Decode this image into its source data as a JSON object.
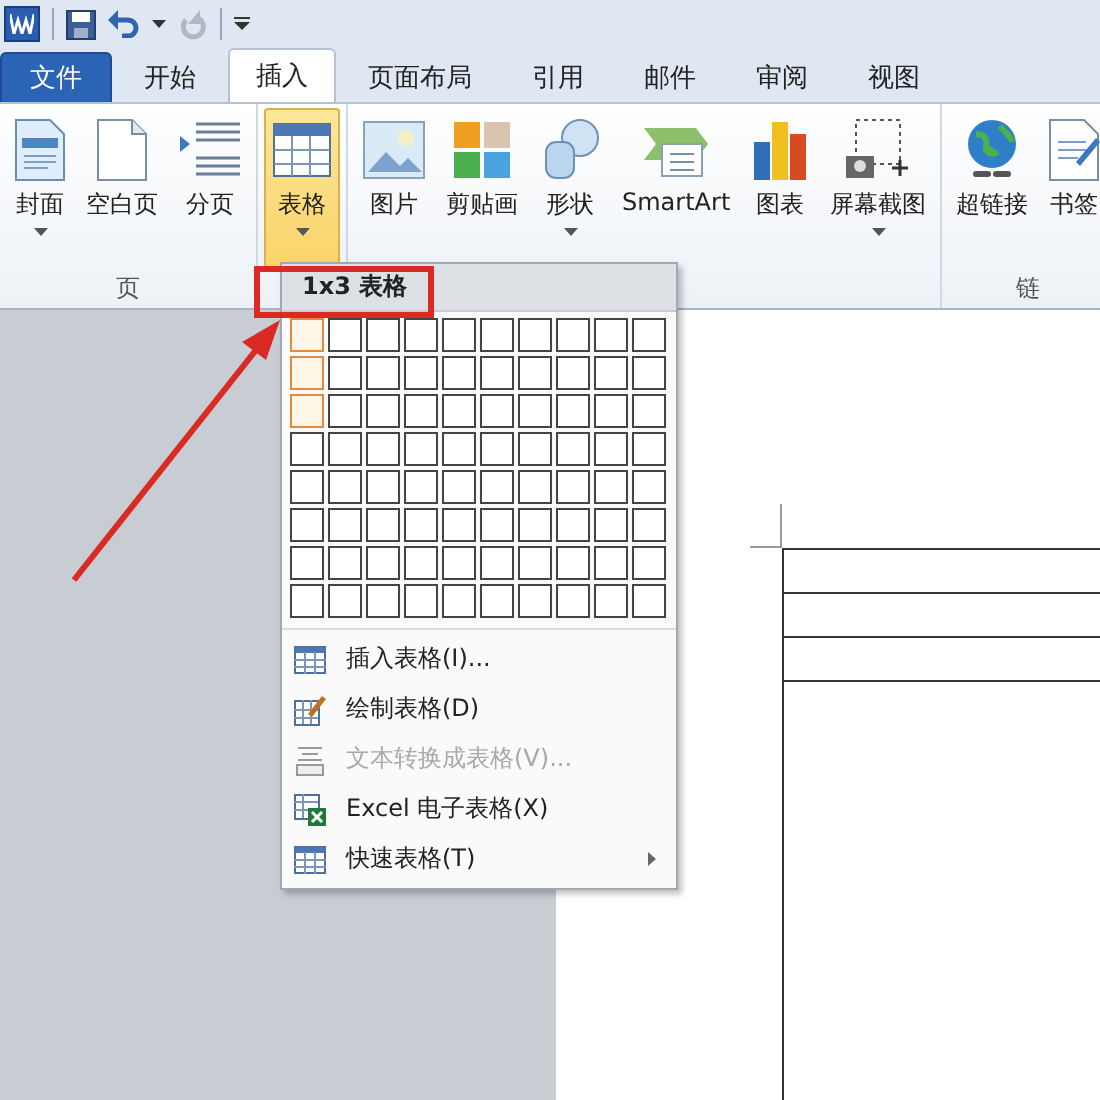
{
  "quick_access": {
    "redo_disabled": true
  },
  "tabs": [
    {
      "label": "文件",
      "kind": "file",
      "selected": false
    },
    {
      "label": "开始",
      "kind": "tab",
      "selected": false
    },
    {
      "label": "插入",
      "kind": "tab",
      "selected": true
    },
    {
      "label": "页面布局",
      "kind": "tab",
      "selected": false
    },
    {
      "label": "引用",
      "kind": "tab",
      "selected": false
    },
    {
      "label": "邮件",
      "kind": "tab",
      "selected": false
    },
    {
      "label": "审阅",
      "kind": "tab",
      "selected": false
    },
    {
      "label": "视图",
      "kind": "tab",
      "selected": false
    }
  ],
  "ribbon_groups": [
    {
      "label": "页",
      "buttons": [
        {
          "label": "封面",
          "dropdown": true,
          "active": false
        },
        {
          "label": "空白页",
          "dropdown": false,
          "active": false
        },
        {
          "label": "分页",
          "dropdown": false,
          "active": false
        }
      ]
    },
    {
      "buttons": [
        {
          "label": "表格",
          "dropdown": true,
          "active": true
        }
      ]
    },
    {
      "buttons": [
        {
          "label": "图片",
          "dropdown": false,
          "active": false
        },
        {
          "label": "剪贴画",
          "dropdown": false,
          "active": false
        },
        {
          "label": "形状",
          "dropdown": true,
          "active": false
        },
        {
          "label": "SmartArt",
          "dropdown": false,
          "active": false
        },
        {
          "label": "图表",
          "dropdown": false,
          "active": false
        },
        {
          "label": "屏幕截图",
          "dropdown": true,
          "active": false
        }
      ]
    },
    {
      "label": "链",
      "buttons": [
        {
          "label": "超链接",
          "dropdown": false,
          "active": false
        },
        {
          "label": "书签",
          "dropdown": false,
          "active": false
        }
      ]
    }
  ],
  "table_menu": {
    "header": "1x3 表格",
    "grid": [
      [
        {
          "selected": true
        },
        {
          "selected": false
        },
        {
          "selected": false
        },
        {
          "selected": false
        },
        {
          "selected": false
        },
        {
          "selected": false
        },
        {
          "selected": false
        },
        {
          "selected": false
        },
        {
          "selected": false
        },
        {
          "selected": false
        }
      ],
      [
        {
          "selected": true
        },
        {
          "selected": false
        },
        {
          "selected": false
        },
        {
          "selected": false
        },
        {
          "selected": false
        },
        {
          "selected": false
        },
        {
          "selected": false
        },
        {
          "selected": false
        },
        {
          "selected": false
        },
        {
          "selected": false
        }
      ],
      [
        {
          "selected": true
        },
        {
          "selected": false
        },
        {
          "selected": false
        },
        {
          "selected": false
        },
        {
          "selected": false
        },
        {
          "selected": false
        },
        {
          "selected": false
        },
        {
          "selected": false
        },
        {
          "selected": false
        },
        {
          "selected": false
        }
      ],
      [
        {
          "selected": false
        },
        {
          "selected": false
        },
        {
          "selected": false
        },
        {
          "selected": false
        },
        {
          "selected": false
        },
        {
          "selected": false
        },
        {
          "selected": false
        },
        {
          "selected": false
        },
        {
          "selected": false
        },
        {
          "selected": false
        }
      ],
      [
        {
          "selected": false
        },
        {
          "selected": false
        },
        {
          "selected": false
        },
        {
          "selected": false
        },
        {
          "selected": false
        },
        {
          "selected": false
        },
        {
          "selected": false
        },
        {
          "selected": false
        },
        {
          "selected": false
        },
        {
          "selected": false
        }
      ],
      [
        {
          "selected": false
        },
        {
          "selected": false
        },
        {
          "selected": false
        },
        {
          "selected": false
        },
        {
          "selected": false
        },
        {
          "selected": false
        },
        {
          "selected": false
        },
        {
          "selected": false
        },
        {
          "selected": false
        },
        {
          "selected": false
        }
      ],
      [
        {
          "selected": false
        },
        {
          "selected": false
        },
        {
          "selected": false
        },
        {
          "selected": false
        },
        {
          "selected": false
        },
        {
          "selected": false
        },
        {
          "selected": false
        },
        {
          "selected": false
        },
        {
          "selected": false
        },
        {
          "selected": false
        }
      ],
      [
        {
          "selected": false
        },
        {
          "selected": false
        },
        {
          "selected": false
        },
        {
          "selected": false
        },
        {
          "selected": false
        },
        {
          "selected": false
        },
        {
          "selected": false
        },
        {
          "selected": false
        },
        {
          "selected": false
        },
        {
          "selected": false
        }
      ]
    ],
    "items": [
      {
        "label": "插入表格(I)...",
        "disabled": false,
        "submenu": false
      },
      {
        "label": "绘制表格(D)",
        "disabled": false,
        "submenu": false
      },
      {
        "label": "文本转换成表格(V)...",
        "disabled": true,
        "submenu": false
      },
      {
        "label": "Excel 电子表格(X)",
        "disabled": false,
        "submenu": false
      },
      {
        "label": "快速表格(T)",
        "disabled": false,
        "submenu": true
      }
    ]
  }
}
